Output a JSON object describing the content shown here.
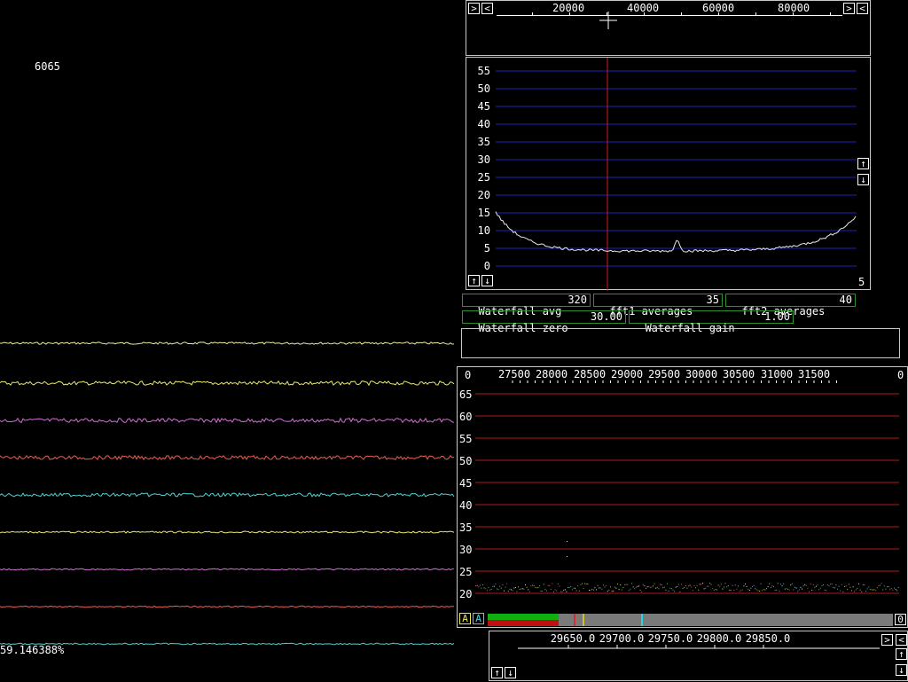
{
  "freq_display": "6065",
  "percent_readout": "59.146388%",
  "top_scale": {
    "ticks": [
      "20000",
      "40000",
      "60000",
      "80000"
    ]
  },
  "spectrum": {
    "y_ticks": [
      "55",
      "50",
      "45",
      "40",
      "35",
      "30",
      "25",
      "20",
      "15",
      "10",
      "5",
      "0"
    ],
    "corner_value": "5"
  },
  "params": {
    "waterfall_avg": {
      "label": "Waterfall avg",
      "value": "320"
    },
    "fft1_averages": {
      "label": "fft1 averages",
      "value": "35"
    },
    "fft2_averages": {
      "label": "fft2 averages",
      "value": "40"
    },
    "waterfall_zero": {
      "label": "Waterfall zero",
      "value": "30.00"
    },
    "waterfall_gain": {
      "label": "Waterfall gain",
      "value": "1.00"
    }
  },
  "baseband": {
    "left_corner": "0",
    "right_corner": "0",
    "x_ticks": [
      "27500",
      "28000",
      "28500",
      "29000",
      "29500",
      "30000",
      "30500",
      "31000",
      "31500"
    ],
    "y_ticks": [
      "65",
      "60",
      "55",
      "50",
      "45",
      "40",
      "35",
      "30",
      "25",
      "20"
    ],
    "bottom_right": "0",
    "btn_a1": "A",
    "btn_a2": "A"
  },
  "hires": {
    "x_ticks": [
      "29650.0",
      "29700.0",
      "29750.0",
      "29800.0",
      "29850.0"
    ]
  },
  "colors": {
    "trace_colors": [
      "#e8e8a0",
      "#e8e870",
      "#d070d0",
      "#e86050",
      "#50d0d0",
      "#e8e870",
      "#d070d0",
      "#e86050",
      "#50d0d0"
    ],
    "grid_blue": "#2020c0",
    "grid_red": "#b01818",
    "cursor_red": "#d02020",
    "panel_border": "#c8c8c8",
    "param_border": "#2f8f2f"
  }
}
